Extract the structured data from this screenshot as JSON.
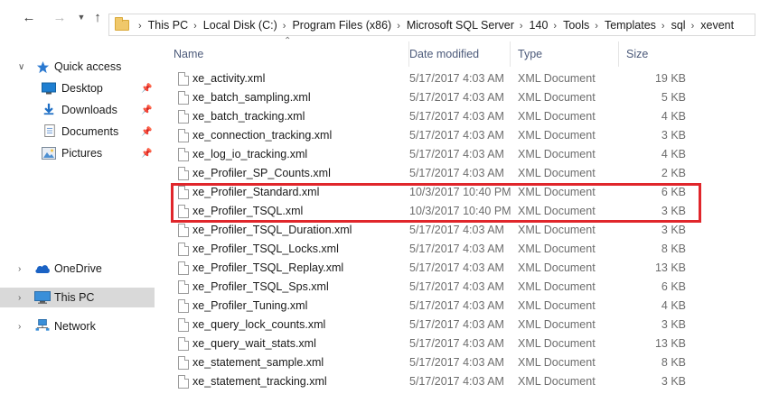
{
  "nav": {
    "back_icon": "arrow-left-icon",
    "forward_icon": "arrow-right-icon",
    "recent_icon": "chevron-down-icon",
    "up_icon": "arrow-up-icon"
  },
  "address": {
    "crumbs": [
      "This PC",
      "Local Disk (C:)",
      "Program Files (x86)",
      "Microsoft SQL Server",
      "140",
      "Tools",
      "Templates",
      "sql",
      "xevent"
    ]
  },
  "sidebar": {
    "quick_access": "Quick access",
    "pinned": [
      {
        "label": "Desktop",
        "icon": "desktop-icon"
      },
      {
        "label": "Downloads",
        "icon": "downloads-icon"
      },
      {
        "label": "Documents",
        "icon": "documents-icon"
      },
      {
        "label": "Pictures",
        "icon": "pictures-icon"
      }
    ],
    "onedrive": "OneDrive",
    "this_pc": "This PC",
    "network": "Network"
  },
  "columns": {
    "name": "Name",
    "date": "Date modified",
    "type": "Type",
    "size": "Size"
  },
  "files": [
    {
      "name": "xe_activity.xml",
      "date": "5/17/2017 4:03 AM",
      "type": "XML Document",
      "size": "19 KB"
    },
    {
      "name": "xe_batch_sampling.xml",
      "date": "5/17/2017 4:03 AM",
      "type": "XML Document",
      "size": "5 KB"
    },
    {
      "name": "xe_batch_tracking.xml",
      "date": "5/17/2017 4:03 AM",
      "type": "XML Document",
      "size": "4 KB"
    },
    {
      "name": "xe_connection_tracking.xml",
      "date": "5/17/2017 4:03 AM",
      "type": "XML Document",
      "size": "3 KB"
    },
    {
      "name": "xe_log_io_tracking.xml",
      "date": "5/17/2017 4:03 AM",
      "type": "XML Document",
      "size": "4 KB"
    },
    {
      "name": "xe_Profiler_SP_Counts.xml",
      "date": "5/17/2017 4:03 AM",
      "type": "XML Document",
      "size": "2 KB"
    },
    {
      "name": "xe_Profiler_Standard.xml",
      "date": "10/3/2017 10:40 PM",
      "type": "XML Document",
      "size": "6 KB"
    },
    {
      "name": "xe_Profiler_TSQL.xml",
      "date": "10/3/2017 10:40 PM",
      "type": "XML Document",
      "size": "3 KB"
    },
    {
      "name": "xe_Profiler_TSQL_Duration.xml",
      "date": "5/17/2017 4:03 AM",
      "type": "XML Document",
      "size": "3 KB"
    },
    {
      "name": "xe_Profiler_TSQL_Locks.xml",
      "date": "5/17/2017 4:03 AM",
      "type": "XML Document",
      "size": "8 KB"
    },
    {
      "name": "xe_Profiler_TSQL_Replay.xml",
      "date": "5/17/2017 4:03 AM",
      "type": "XML Document",
      "size": "13 KB"
    },
    {
      "name": "xe_Profiler_TSQL_Sps.xml",
      "date": "5/17/2017 4:03 AM",
      "type": "XML Document",
      "size": "6 KB"
    },
    {
      "name": "xe_Profiler_Tuning.xml",
      "date": "5/17/2017 4:03 AM",
      "type": "XML Document",
      "size": "4 KB"
    },
    {
      "name": "xe_query_lock_counts.xml",
      "date": "5/17/2017 4:03 AM",
      "type": "XML Document",
      "size": "3 KB"
    },
    {
      "name": "xe_query_wait_stats.xml",
      "date": "5/17/2017 4:03 AM",
      "type": "XML Document",
      "size": "13 KB"
    },
    {
      "name": "xe_statement_sample.xml",
      "date": "5/17/2017 4:03 AM",
      "type": "XML Document",
      "size": "8 KB"
    },
    {
      "name": "xe_statement_tracking.xml",
      "date": "5/17/2017 4:03 AM",
      "type": "XML Document",
      "size": "3 KB"
    }
  ],
  "colors": {
    "highlight_border": "#e0262b",
    "header_text": "#4c5a7a",
    "selected_bg": "#d9d9d9",
    "quick_access_star": "#2b79d0"
  }
}
